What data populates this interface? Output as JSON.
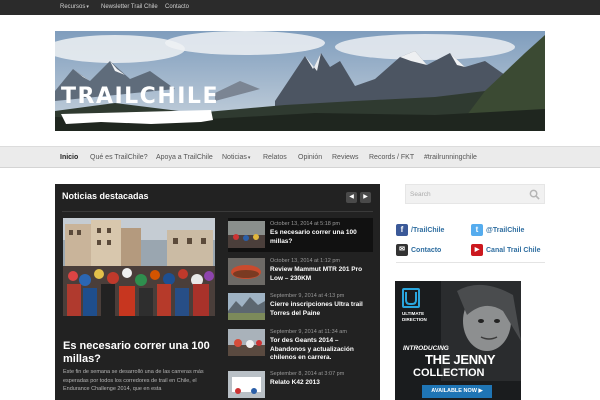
{
  "topbar": {
    "items": [
      "Recursos",
      "Newsletter Trail Chile",
      "Contacto"
    ]
  },
  "banner": {
    "logo_text": "TRAILCHILE"
  },
  "nav": {
    "items": [
      "Inicio",
      "Qué es TrailChile?",
      "Apoya a TrailChile",
      "Noticias",
      "Relatos",
      "Opinión",
      "Reviews",
      "Records / FKT",
      "#trailrunningchile"
    ]
  },
  "featured": {
    "title": "Noticias destacadas",
    "prev_icon": "chevron-left-icon",
    "next_icon": "chevron-right-icon",
    "main": {
      "title": "Es necesario correr una 100 millas?",
      "excerpt": "Este fin de semana se desarrolló una de las carreras más esperadas por todos los corredores de trail en Chile, el Endurance Challenge 2014, que en esta"
    },
    "items": [
      {
        "date": "October 13, 2014 at 5:18 pm",
        "title": "Es necesario correr una 100 millas?"
      },
      {
        "date": "October 13, 2014 at 1:12 pm",
        "title": "Review Mammut MTR 201 Pro Low – 230KM"
      },
      {
        "date": "September 9, 2014 at 4:13 pm",
        "title": "Cierre inscripciones Ultra trail Torres del Paine"
      },
      {
        "date": "September 9, 2014 at 11:34 am",
        "title": "Tor des Geants 2014 – Abandonos y actualización chilenos en carrera."
      },
      {
        "date": "September 8, 2014 at 3:07 pm",
        "title": "Relato K42 2013"
      }
    ]
  },
  "sidebar": {
    "search_placeholder": "Search",
    "social": [
      {
        "icon": "facebook-icon",
        "glyph": "f",
        "color": "#3b5998",
        "label": "/TrailChile"
      },
      {
        "icon": "twitter-icon",
        "glyph": "t",
        "color": "#55acee",
        "label": "@TrailChile"
      },
      {
        "icon": "mail-icon",
        "glyph": "✉",
        "color": "#333333",
        "label": "Contacto"
      },
      {
        "icon": "youtube-icon",
        "glyph": "▶",
        "color": "#cc181e",
        "label": "Canal Trail Chile"
      }
    ],
    "ad": {
      "brand_line1": "ULTIMATE",
      "brand_line2": "DIRECTION",
      "intro": "INTRODUCING",
      "line2": "THE JENNY",
      "line3": "COLLECTION",
      "cta": "AVAILABLE NOW ▶"
    }
  },
  "colors": {
    "topbar": "#2b2b2b",
    "panel": "#222222",
    "link_blue": "#2f6ea0",
    "ad_blue": "#1f75b5"
  }
}
